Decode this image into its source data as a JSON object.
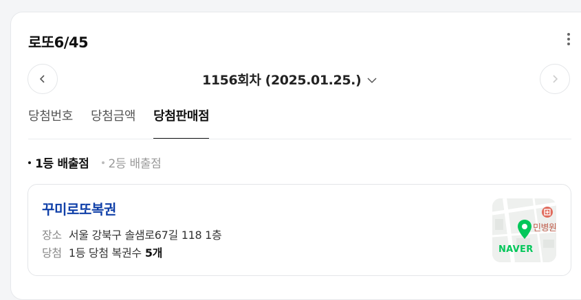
{
  "header": {
    "title": "로또6/45"
  },
  "round_nav": {
    "current": "1156회차 (2025.01.25.)"
  },
  "tabs": [
    {
      "label": "당첨번호",
      "active": false
    },
    {
      "label": "당첨금액",
      "active": false
    },
    {
      "label": "당첨판매점",
      "active": true
    }
  ],
  "filters": [
    {
      "label": "1등 배출점",
      "active": true
    },
    {
      "label": "2등 배출점",
      "active": false
    }
  ],
  "store": {
    "name": "꾸미로또복권",
    "address_label": "장소",
    "address": "서울 강북구 솔샘로67길 118 1층",
    "win_label": "당첨",
    "win_text": "1등 당첨 복권수",
    "win_count": "5개",
    "map": {
      "brand": "NAVER",
      "poi_label": "민병원",
      "pin_color": "#03c75a",
      "poi_color": "#e06b5c"
    }
  },
  "icons": {
    "prev": "chevron-left-icon",
    "next": "chevron-right-icon",
    "dropdown": "chevron-down-icon",
    "more": "more-vertical-icon"
  },
  "colors": {
    "store_name": "#0f3fa8",
    "naver_green": "#03c75a"
  }
}
